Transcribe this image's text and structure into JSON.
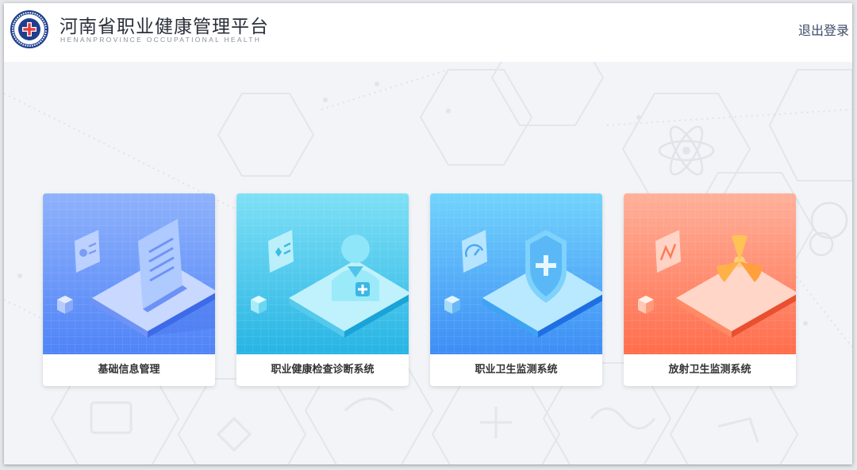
{
  "header": {
    "title": "河南省职业健康管理平台",
    "subtitle": "HENANPROVINCE OCCUPATIONAL HEALTH",
    "logout": "退出登录"
  },
  "colors": {
    "card1": [
      "#8fb2fb",
      "#4f83f7"
    ],
    "card2": [
      "#7fe0f6",
      "#27b4e4"
    ],
    "card3": [
      "#72d4fc",
      "#3d8df5"
    ],
    "card4": [
      "#ffb09a",
      "#ff6d4c"
    ]
  },
  "cards": [
    {
      "label": "基础信息管理",
      "icon": "document-icon"
    },
    {
      "label": "职业健康检查诊断系统",
      "icon": "doctor-icon"
    },
    {
      "label": "职业卫生监测系统",
      "icon": "shield-icon"
    },
    {
      "label": "放射卫生监测系统",
      "icon": "radiation-icon"
    }
  ]
}
